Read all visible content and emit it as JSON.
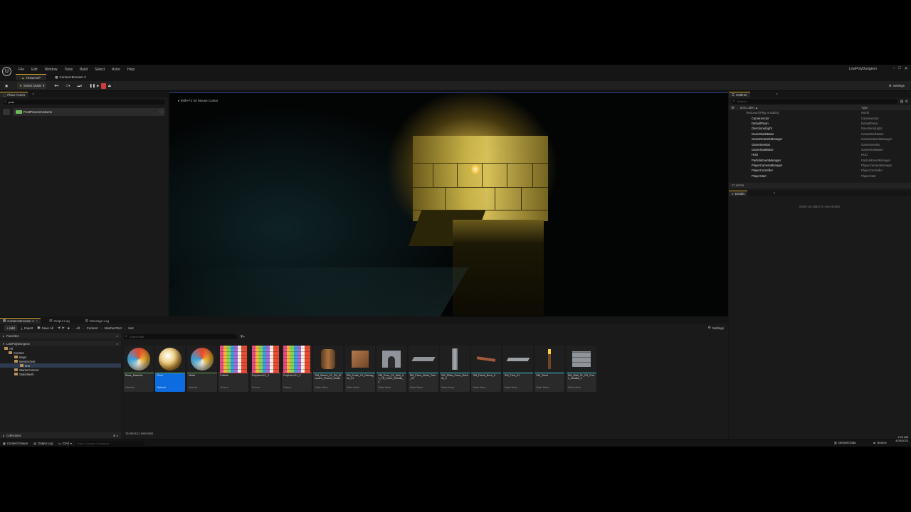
{
  "menu": [
    "File",
    "Edit",
    "Window",
    "Tools",
    "Build",
    "Select",
    "Actor",
    "Help"
  ],
  "project_name": "LowPolyDungeon",
  "window_controls": [
    "–",
    "□",
    "✕"
  ],
  "tabs": [
    "TestLevel*",
    "Content Browser 2"
  ],
  "toolbar": {
    "select_mode": "Select Mode",
    "settings": "Settings"
  },
  "place_actors": {
    "tab": "Place Actors",
    "search_value": "post",
    "result": "PostProcessVolume"
  },
  "viewport": {
    "hint": "Shift+F1 for Mouse Cursor"
  },
  "outliner": {
    "tab": "Outliner",
    "search_placeholder": "Search...",
    "col_label": "Item Label ▲",
    "col_type": "Type",
    "root": "TestLevel (Play In Editor)",
    "root_type": "World",
    "items": [
      {
        "name": "CameraActor",
        "type": "CameraActor"
      },
      {
        "name": "DefaultPawn",
        "type": "DefaultPawn"
      },
      {
        "name": "DirectionalLight",
        "type": "DirectionalLight"
      },
      {
        "name": "GameModeBase",
        "type": "GameModeBase"
      },
      {
        "name": "GameNetworkManager",
        "type": "GameNetworkManager"
      },
      {
        "name": "GameSession",
        "type": "GameSession"
      },
      {
        "name": "GameStateBase",
        "type": "GameStateBase"
      },
      {
        "name": "HUD",
        "type": "HUD"
      },
      {
        "name": "ParticleEventManager",
        "type": "ParticleEventManager"
      },
      {
        "name": "PlayerCameraManager",
        "type": "PlayerCameraManager"
      },
      {
        "name": "PlayerController",
        "type": "PlayerController"
      },
      {
        "name": "PlayerStart",
        "type": "PlayerStart"
      }
    ],
    "count": "17 actors"
  },
  "details": {
    "tab": "Details",
    "empty": "Select an object to view details."
  },
  "bottom_tabs": [
    "Content Browser 1",
    "Output Log",
    "Message Log"
  ],
  "cb": {
    "add": "+ Add",
    "import": "Import",
    "save_all": "Save All",
    "path": [
      "All",
      "Content",
      "MeshesTest",
      "test"
    ],
    "settings": "Settings",
    "search_placeholder": "Search test",
    "favorites": "Favorites",
    "project": "LowPolyDungeon",
    "tree": [
      "All",
      "Content",
      "Maps",
      "MeshesTest",
      "test",
      "StarterContent",
      "StaticMesh"
    ],
    "collections": "Collections",
    "status": "15 items (1 selected)",
    "assets": [
      {
        "name": "Base_Material",
        "type": "Material",
        "kind": "sphere"
      },
      {
        "name": "Glow",
        "type": "Material",
        "kind": "sphere"
      },
      {
        "name": "Metal",
        "type": "Material",
        "kind": "sphere"
      },
      {
        "name": "Palette",
        "type": "Texture",
        "kind": "palette"
      },
      {
        "name": "PolyHeroX1_1",
        "type": "Texture",
        "kind": "palette"
      },
      {
        "name": "PolyHeroX1_2",
        "type": "Texture",
        "kind": "palette"
      },
      {
        "name": "SM_Barrel_01_Fill_Wooden_Round_Small",
        "type": "Static Mesh",
        "kind": "barrel"
      },
      {
        "name": "SM_Crate_01_Damaged_01",
        "type": "Static Mesh",
        "kind": "crate"
      },
      {
        "name": "SM_Door_01_Wall_01_Fill_Cube_Details_2",
        "type": "Static Mesh",
        "kind": "arch"
      },
      {
        "name": "SM_Floor_Wide_Trim_01",
        "type": "Static Mesh",
        "kind": "floor"
      },
      {
        "name": "SM_Pillar_Cube_Details_2",
        "type": "Static Mesh",
        "kind": "pillar"
      },
      {
        "name": "SM_Plank_Bent_3",
        "type": "Static Mesh",
        "kind": "plank"
      },
      {
        "name": "SM_Trim_01",
        "type": "Static Mesh",
        "kind": "trim"
      },
      {
        "name": "SM_Torch",
        "type": "Static Mesh",
        "kind": "torch"
      },
      {
        "name": "SM_Wall_01_Fill_Cube_Details_2",
        "type": "Static Mesh",
        "kind": "wall"
      }
    ]
  },
  "status": {
    "content_drawer": "Content Drawer",
    "output_log": "Output Log",
    "cmd": "Cmd",
    "console_placeholder": "Enter Console Command",
    "derived": "Derived Data",
    "source": "Source",
    "time": "2:23 AM",
    "date": "4/26/2022"
  },
  "colors": {
    "accent": "#d7a12a",
    "selection": "#0d6ce0",
    "stop": "#d33b3b"
  }
}
